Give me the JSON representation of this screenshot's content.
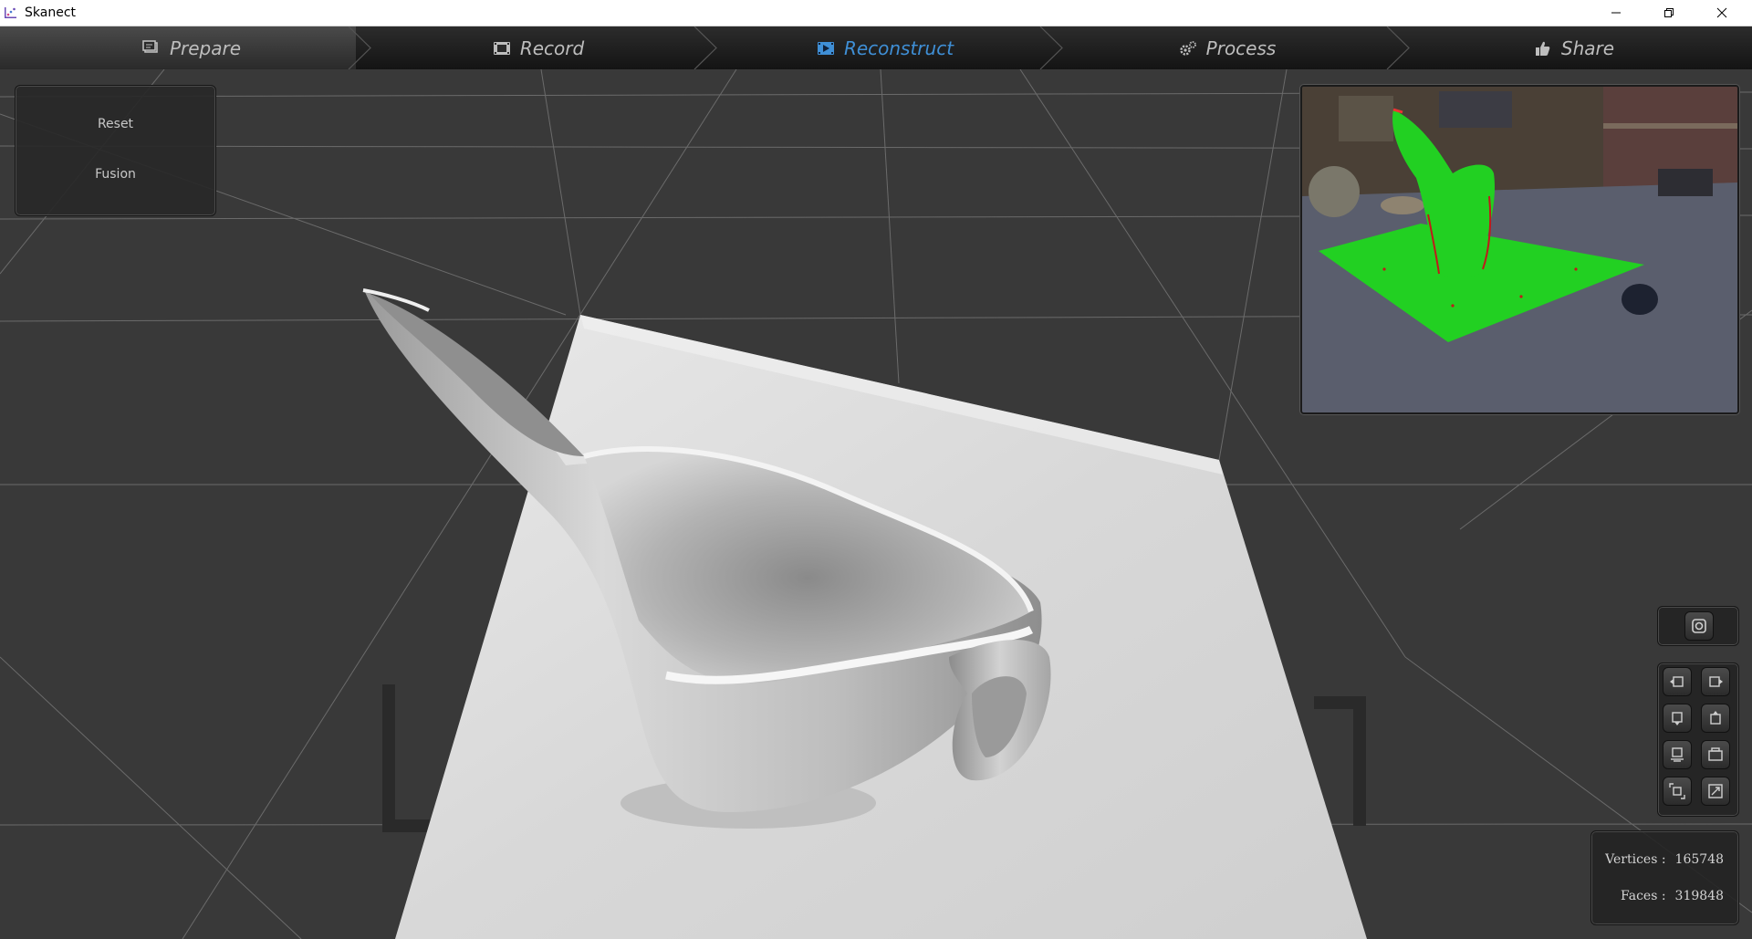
{
  "window": {
    "title": "Skanect"
  },
  "tabs": [
    {
      "label": "Prepare",
      "icon": "prepare-icon",
      "active": false
    },
    {
      "label": "Record",
      "icon": "record-icon",
      "active": false
    },
    {
      "label": "Reconstruct",
      "icon": "reconstruct-icon",
      "active": true
    },
    {
      "label": "Process",
      "icon": "process-icon",
      "active": false
    },
    {
      "label": "Share",
      "icon": "share-icon",
      "active": false
    }
  ],
  "left_panel": {
    "reset_label": "Reset",
    "fusion_label": "Fusion"
  },
  "stats": {
    "vertices_label": "Vertices :",
    "vertices_value": "165748",
    "faces_label": "Faces :",
    "faces_value": "319848"
  },
  "colors": {
    "active_tab": "#3f8fd6",
    "inactive_tab": "#bdbdbd",
    "mesh_overlay": "#22d022",
    "viewport_bg": "#393939"
  }
}
